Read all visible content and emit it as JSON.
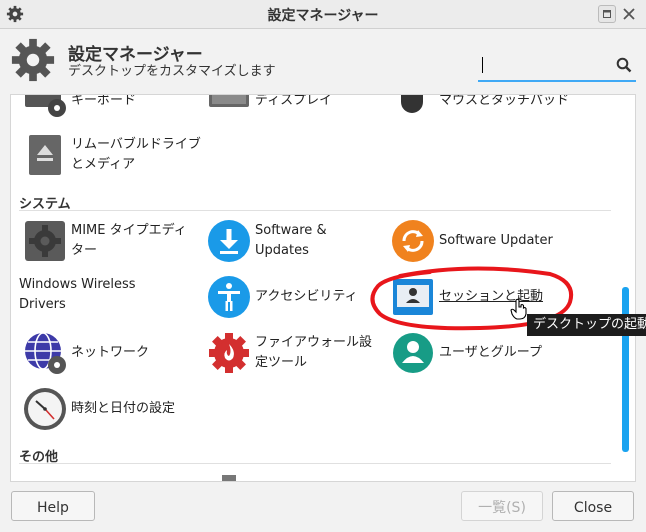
{
  "window": {
    "title": "設定マネージャー"
  },
  "header": {
    "title": "設定マネージャー",
    "subtitle": "デスクトップをカスタマイズします",
    "search": {
      "value": "",
      "placeholder": ""
    }
  },
  "hardware_partial": {
    "items": [
      {
        "label": "キーボード",
        "icon": "keyboard-icon"
      },
      {
        "label": "ディスプレイ",
        "icon": "display-icon"
      },
      {
        "label": "マウスとタッチパッド",
        "icon": "mouse-icon"
      }
    ],
    "removable": {
      "label": "リムーバブルドライブとメディア",
      "icon": "eject-icon"
    }
  },
  "system": {
    "heading": "システム",
    "items": [
      {
        "label": "MIME タイプエディター",
        "icon": "gear-icon"
      },
      {
        "label": "Software & Updates",
        "icon": "download-icon"
      },
      {
        "label": "Software Updater",
        "icon": "refresh-icon"
      },
      {
        "label": "Windows Wireless Drivers",
        "icon": ""
      },
      {
        "label": "アクセシビリティ",
        "icon": "accessibility-icon"
      },
      {
        "label": "セッションと起動",
        "icon": "session-icon"
      },
      {
        "label": "ネットワーク",
        "icon": "network-icon"
      },
      {
        "label": "ファイアウォール設定ツール",
        "icon": "firewall-icon"
      },
      {
        "label": "ユーザとグループ",
        "icon": "users-icon"
      },
      {
        "label": "時刻と日付の設定",
        "icon": "clock-icon"
      }
    ]
  },
  "other": {
    "heading": "その他"
  },
  "tooltip": "デスクトップの起動",
  "buttons": {
    "help": "Help",
    "all": "一覧(S)",
    "close": "Close"
  },
  "colors": {
    "accent": "#1aa3f0",
    "annotation": "#e8161b"
  }
}
